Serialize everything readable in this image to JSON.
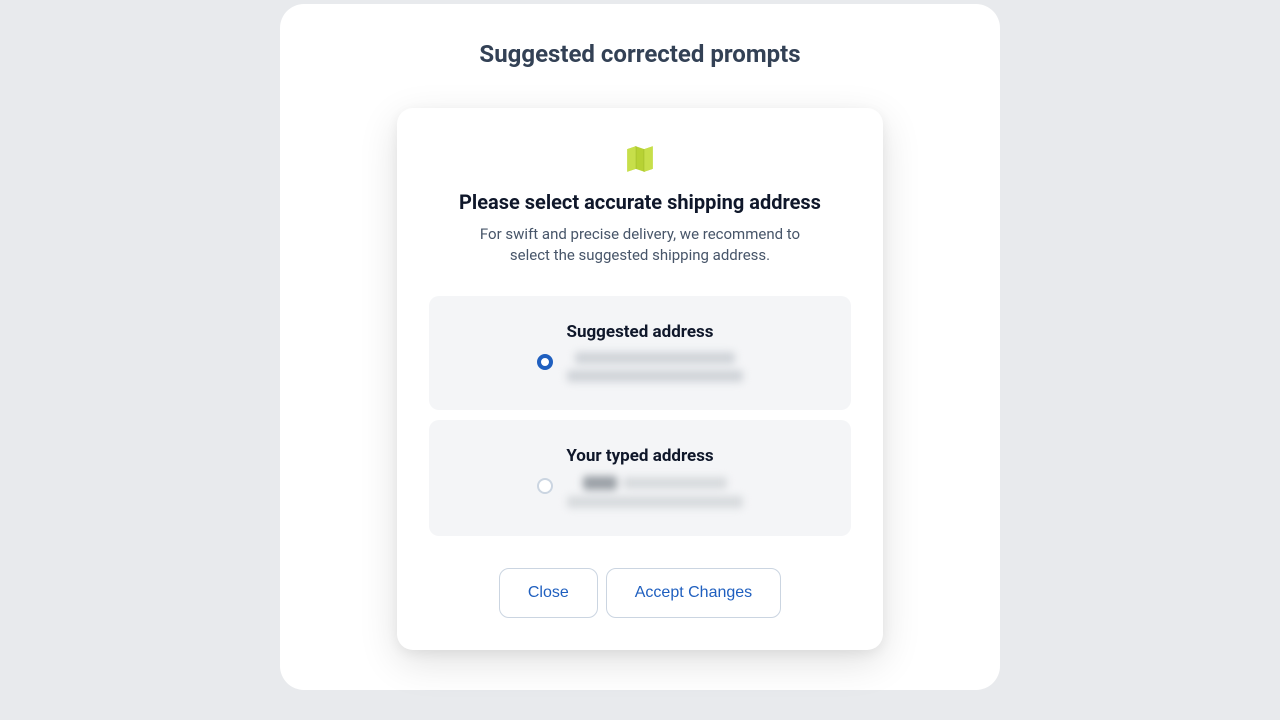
{
  "page": {
    "title": "Suggested corrected prompts"
  },
  "modal": {
    "icon": "map-icon",
    "title": "Please select accurate shipping address",
    "description": "For swift and precise delivery, we recommend to select the suggested shipping address.",
    "options": {
      "suggested": {
        "title": "Suggested address",
        "selected": true
      },
      "typed": {
        "title": "Your typed address",
        "selected": false
      }
    },
    "buttons": {
      "close": "Close",
      "accept": "Accept Changes"
    }
  },
  "colors": {
    "accent": "#1f5fbf",
    "icon": "#b7d234"
  }
}
